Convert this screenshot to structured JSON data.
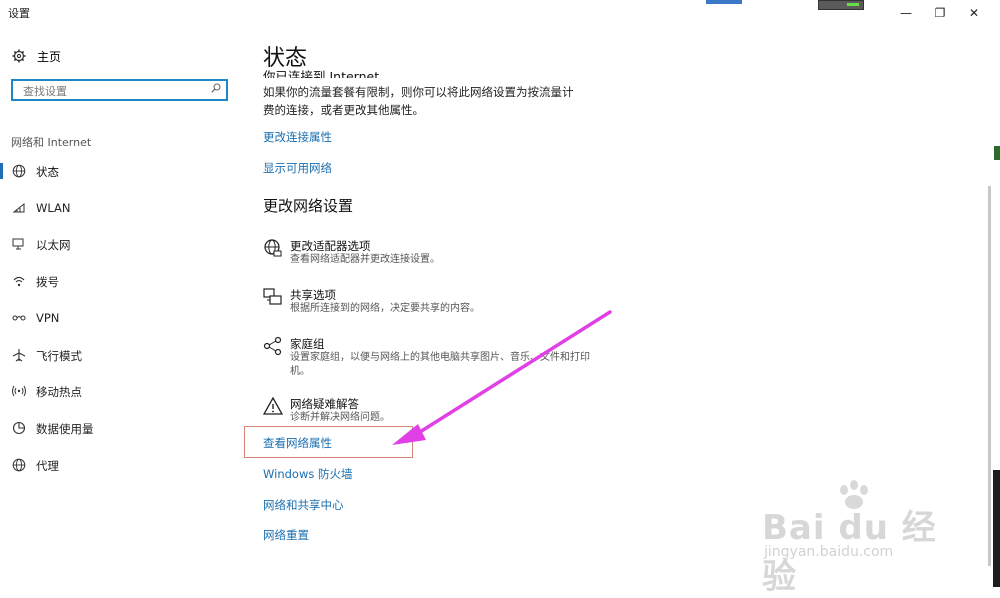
{
  "window": {
    "title": "设置",
    "minimize_glyph": "—",
    "restore_glyph": "❐",
    "close_glyph": "✕"
  },
  "sidebar": {
    "home_label": "主页",
    "search_placeholder": "查找设置",
    "section_label": "网络和 Internet",
    "items": [
      {
        "label": "状态",
        "icon": "globe-icon",
        "active": true
      },
      {
        "label": "WLAN",
        "icon": "wifi-icon"
      },
      {
        "label": "以太网",
        "icon": "ethernet-icon"
      },
      {
        "label": "拨号",
        "icon": "dialup-icon"
      },
      {
        "label": "VPN",
        "icon": "vpn-icon"
      },
      {
        "label": "飞行模式",
        "icon": "airplane-icon"
      },
      {
        "label": "移动热点",
        "icon": "hotspot-icon"
      },
      {
        "label": "数据使用量",
        "icon": "data-usage-icon"
      },
      {
        "label": "代理",
        "icon": "proxy-globe-icon"
      }
    ]
  },
  "main": {
    "title": "状态",
    "clipped_heading": "你已连接到 Internet",
    "metered_text": "如果你的流量套餐有限制，则你可以将此网络设置为按流量计费的连接，或者更改其他属性。",
    "links_top": [
      "更改连接属性",
      "显示可用网络"
    ],
    "section_heading": "更改网络设置",
    "options": [
      {
        "title": "更改适配器选项",
        "desc": "查看网络适配器并更改连接设置。",
        "icon": "adapter-globe-icon"
      },
      {
        "title": "共享选项",
        "desc": "根据所连接到的网络，决定要共享的内容。",
        "icon": "sharing-icon"
      },
      {
        "title": "家庭组",
        "desc": "设置家庭组，以便与网络上的其他电脑共享图片、音乐、文件和打印机。",
        "icon": "homegroup-icon"
      },
      {
        "title": "网络疑难解答",
        "desc": "诊断并解决网络问题。",
        "icon": "warning-icon"
      }
    ],
    "links_bottom": [
      "查看网络属性",
      "Windows 防火墙",
      "网络和共享中心",
      "网络重置"
    ]
  },
  "watermark": {
    "brand": "Bai du 经验",
    "url": "jingyan.baidu.com"
  },
  "colors": {
    "link": "#1a6fb0",
    "accent": "#1e88c7",
    "highlight_border": "#d8837a",
    "arrow": "#e040e6"
  }
}
